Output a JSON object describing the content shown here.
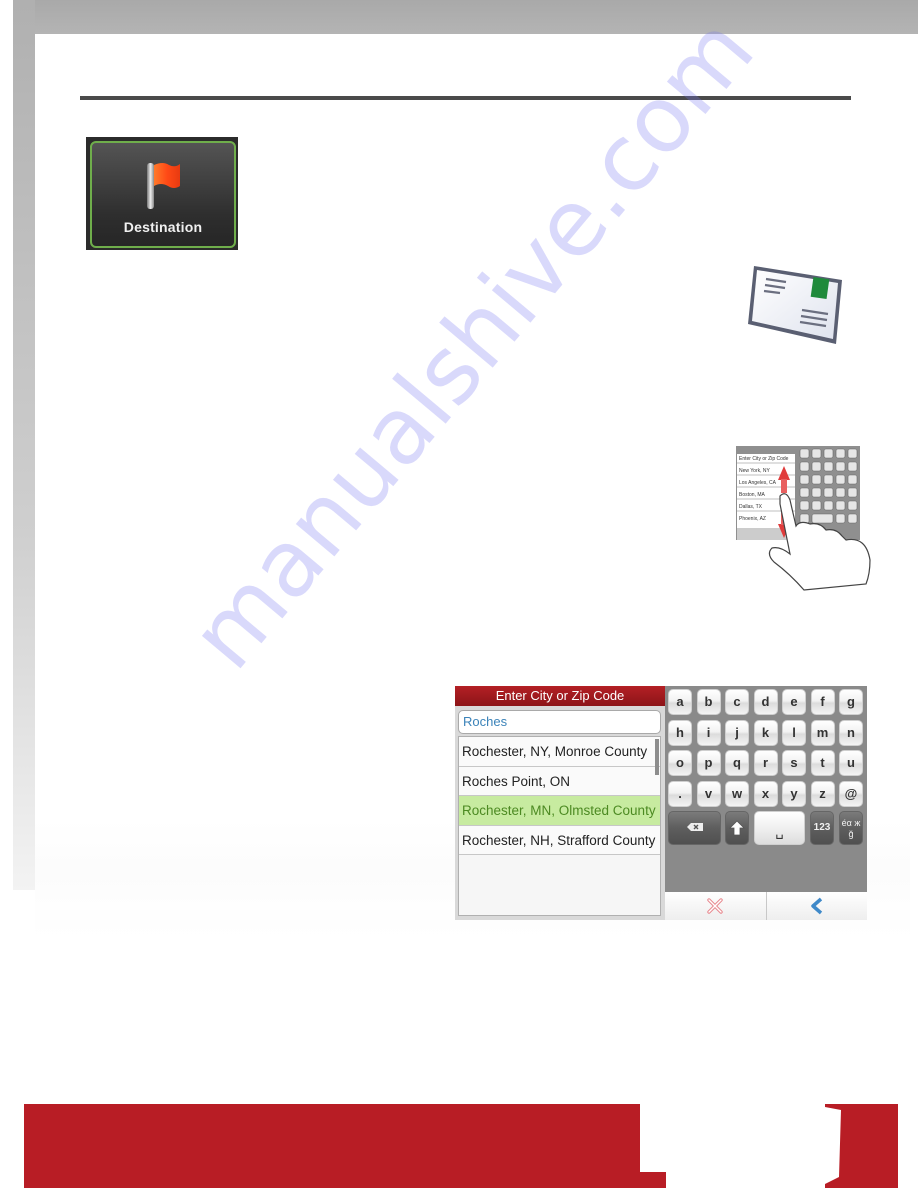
{
  "destination_button": {
    "label": "Destination"
  },
  "device_screen": {
    "header": "Enter City or Zip Code",
    "search_value": "Roches",
    "results": [
      {
        "label": "Rochester, NY, Monroe County",
        "selected": false
      },
      {
        "label": "Roches Point, ON",
        "selected": false
      },
      {
        "label": "Rochester, MN, Olmsted County",
        "selected": true
      },
      {
        "label": "Rochester, NH, Strafford County",
        "selected": false
      }
    ],
    "keyboard": {
      "rows": [
        [
          "a",
          "b",
          "c",
          "d",
          "e",
          "f",
          "g"
        ],
        [
          "h",
          "i",
          "j",
          "k",
          "l",
          "m",
          "n"
        ],
        [
          "o",
          "p",
          "q",
          "r",
          "s",
          "t",
          "u"
        ],
        [
          ".",
          "v",
          "w",
          "x",
          "y",
          "z",
          "@"
        ]
      ],
      "numbers_key": "123",
      "accents_key": "éα ж ğ",
      "space_key": "␣"
    },
    "bottom_buttons": [
      "cancel",
      "back"
    ]
  },
  "hand_icon_list": [
    "Enter City or Zip Code",
    "New York, NY",
    "Los Angeles, CA",
    "Boston, MA",
    "Dallas, TX",
    "Phoenix, AZ"
  ],
  "watermark": "manualshive.com",
  "colors": {
    "brand_red": "#b81d25",
    "selected_row": "#c7eba0",
    "selected_text": "#4c8a22",
    "button_border": "#6fae4b",
    "search_text": "#3b83b9"
  }
}
